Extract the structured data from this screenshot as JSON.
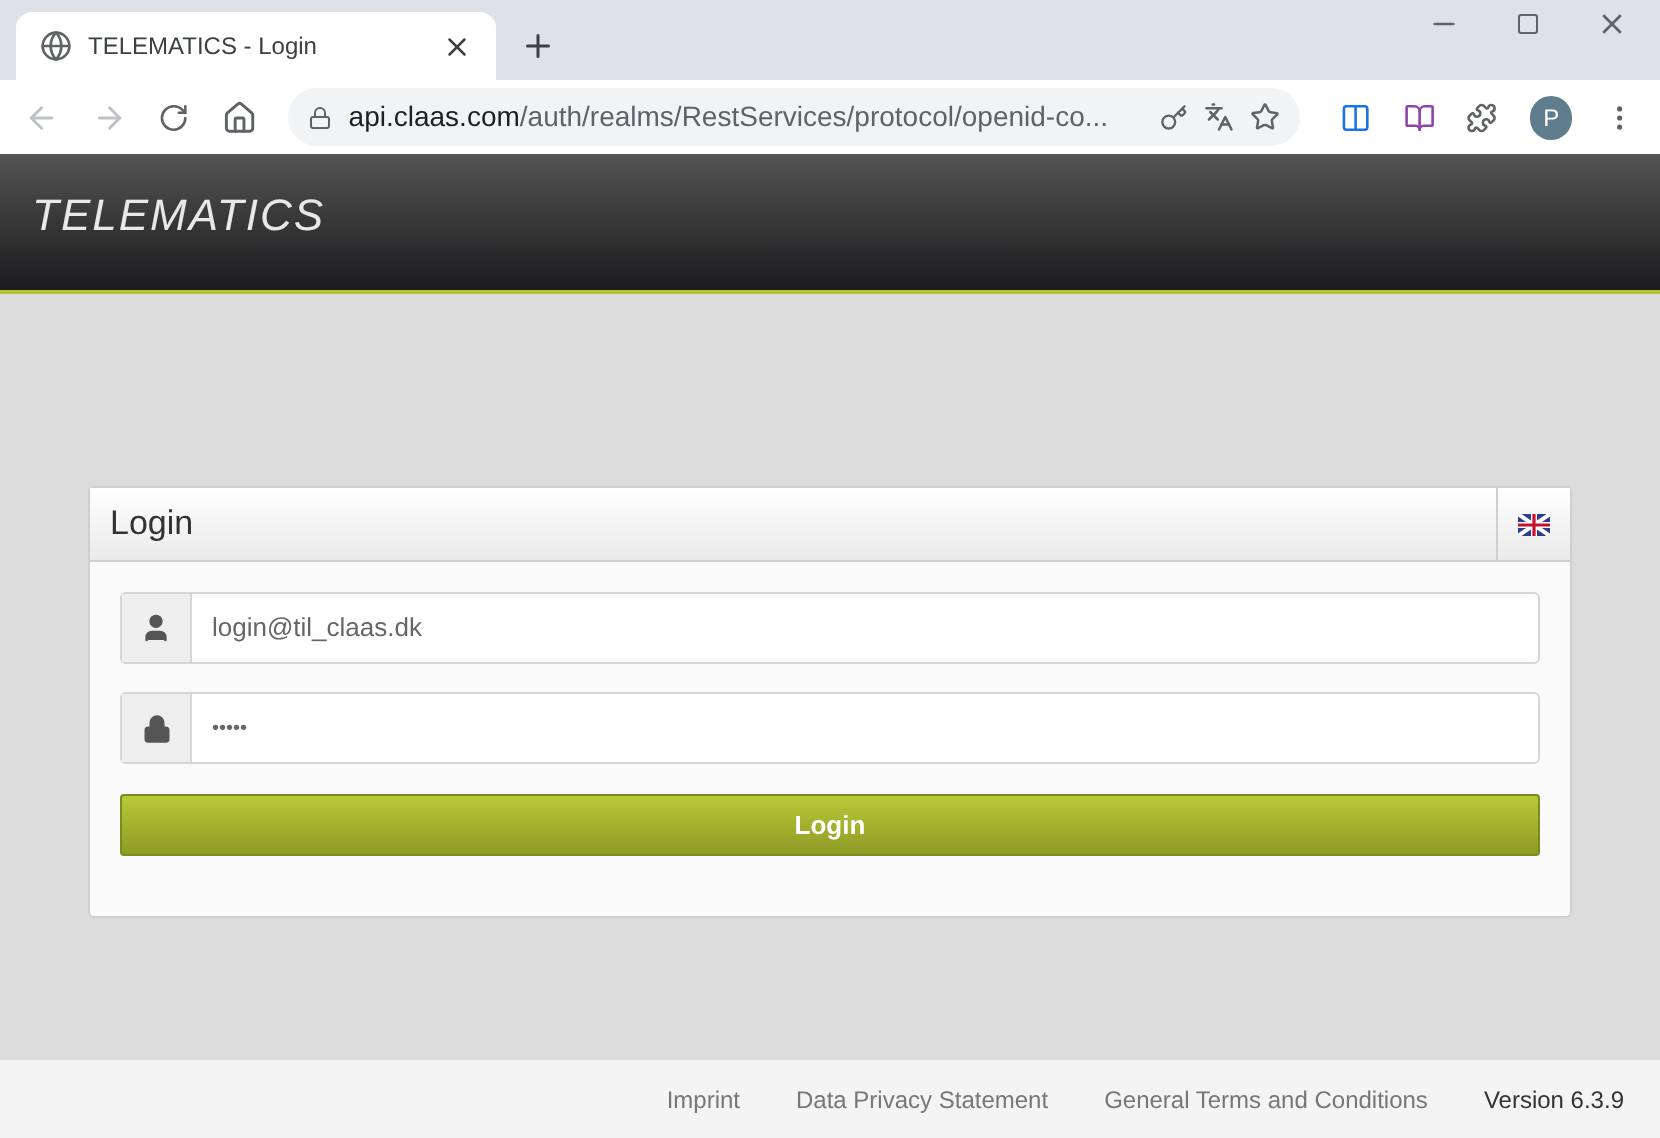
{
  "browser": {
    "tab_title": "TELEMATICS - Login",
    "url_host": "api.claas.com",
    "url_path": "/auth/realms/RestServices/protocol/openid-co...",
    "profile_initial": "P"
  },
  "header": {
    "logo": "TELEMATICS"
  },
  "login_panel": {
    "title": "Login",
    "username": {
      "value": "login@til_claas.dk"
    },
    "password": {
      "value": "•••••"
    },
    "submit": "Login"
  },
  "footer": {
    "links": [
      "Imprint",
      "Data Privacy Statement",
      "General Terms and Conditions"
    ],
    "version": "Version 6.3.9"
  }
}
